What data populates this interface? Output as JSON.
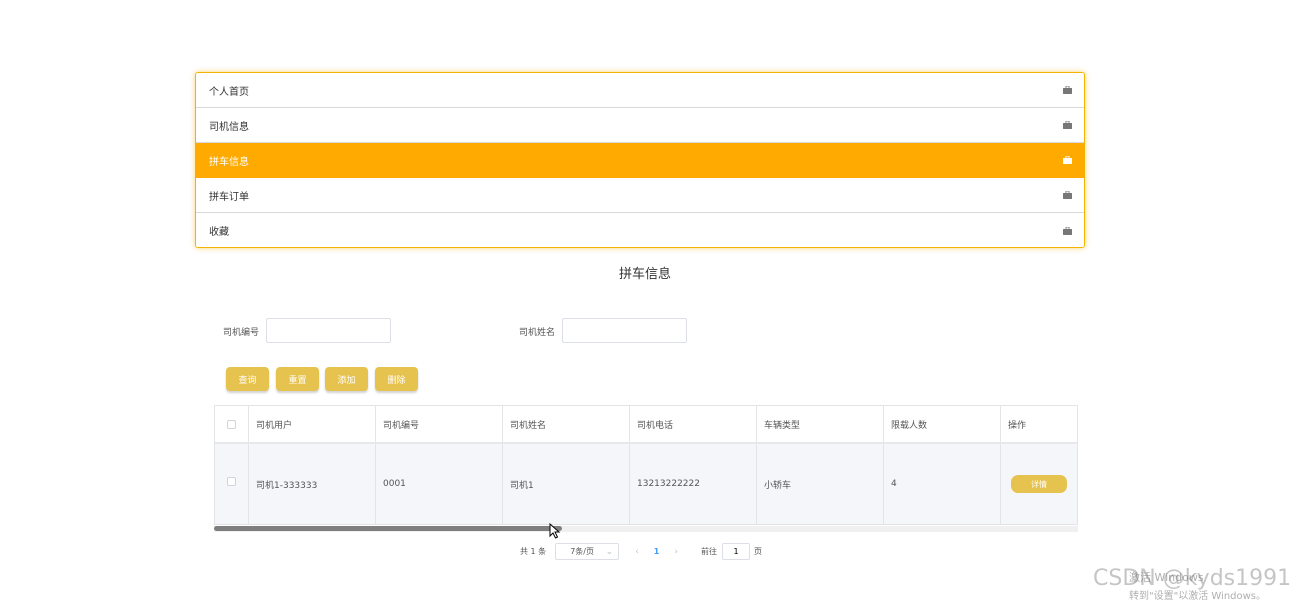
{
  "menu": {
    "items": [
      {
        "label": "个人首页",
        "active": false
      },
      {
        "label": "司机信息",
        "active": false
      },
      {
        "label": "拼车信息",
        "active": true
      },
      {
        "label": "拼车订单",
        "active": false
      },
      {
        "label": "收藏",
        "active": false
      }
    ],
    "icon": "briefcase-icon",
    "active_color": "#ffaa00"
  },
  "page": {
    "title": "拼车信息"
  },
  "search": {
    "driver_no_label": "司机编号",
    "driver_no_value": "",
    "driver_name_label": "司机姓名",
    "driver_name_value": ""
  },
  "actions": {
    "query": "查询",
    "reset": "重置",
    "add": "添加",
    "delete": "删除",
    "color": "#e6c24e"
  },
  "table": {
    "columns": [
      "司机用户",
      "司机编号",
      "司机姓名",
      "司机电话",
      "车辆类型",
      "限载人数",
      "操作"
    ],
    "rows": [
      {
        "driver_user": "司机1-333333",
        "driver_no": "0001",
        "driver_name": "司机1",
        "driver_phone": "13213222222",
        "vehicle_type": "小轿车",
        "seat_limit": "4",
        "action": "详情"
      }
    ]
  },
  "pagination": {
    "total": "共 1 条",
    "page_size": "7条/页",
    "current_page": "1",
    "goto_label": "前往",
    "goto_value": "1",
    "page_unit": "页"
  },
  "watermark": {
    "csdn": "CSDN @kyds1991",
    "activate_title": "激活 Windows",
    "activate_hint": "转到\"设置\"以激活 Windows。"
  }
}
